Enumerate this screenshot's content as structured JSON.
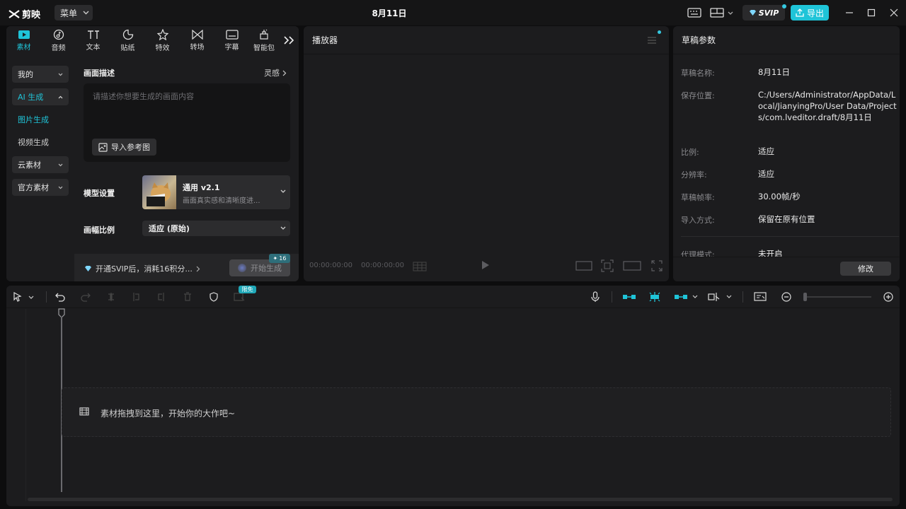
{
  "app": {
    "name": "剪映",
    "menu_label": "菜单",
    "title": "8月11日",
    "svip_label": "SVIP",
    "export_label": "导出"
  },
  "colors": {
    "accent": "#1fc4d8",
    "bg": "#0d0d0e",
    "panel": "#1c1c1e"
  },
  "media_tabs": [
    {
      "label": "素材",
      "icon": "media-icon",
      "active": true
    },
    {
      "label": "音频",
      "icon": "audio-icon"
    },
    {
      "label": "文本",
      "icon": "text-icon"
    },
    {
      "label": "贴纸",
      "icon": "sticker-icon"
    },
    {
      "label": "特效",
      "icon": "effects-icon"
    },
    {
      "label": "转场",
      "icon": "transition-icon"
    },
    {
      "label": "字幕",
      "icon": "subtitle-icon"
    },
    {
      "label": "智能包",
      "icon": "smart-icon"
    }
  ],
  "side_nav": {
    "mine": "我的",
    "ai_gen": "AI 生成",
    "image_gen": "图片生成",
    "video_gen": "视频生成",
    "cloud": "云素材",
    "official": "官方素材"
  },
  "ai_panel": {
    "desc_title": "画面描述",
    "inspiration": "灵感",
    "placeholder": "请描述你想要生成的画面内容",
    "import_ref": "导入参考图",
    "model_label": "模型设置",
    "model_name": "通用 v2.1",
    "model_desc": "画面真实感和清晰度进...",
    "ratio_label": "画幅比例",
    "ratio_value": "适应 (原始)",
    "svip_promo": "开通SVIP后，消耗16积分...",
    "generate": "开始生成",
    "cost": "16"
  },
  "player": {
    "title": "播放器",
    "time_current": "00:00:00:00",
    "time_total": "00:00:00:00"
  },
  "draft": {
    "title": "草稿参数",
    "rows": [
      {
        "key": "草稿名称:",
        "value": "8月11日"
      },
      {
        "key": "保存位置:",
        "value": "C:/Users/Administrator/AppData/Local/JianyingPro/User Data/Projects/com.lveditor.draft/8月11日"
      },
      {
        "key": "比例:",
        "value": "适应"
      },
      {
        "key": "分辨率:",
        "value": "适应"
      },
      {
        "key": "草稿帧率:",
        "value": "30.00帧/秒"
      },
      {
        "key": "导入方式:",
        "value": "保留在原有位置"
      },
      {
        "key": "代理模式:",
        "value": "未开启"
      }
    ],
    "edit": "修改"
  },
  "timeline": {
    "limited_free": "限免",
    "drop_hint": "素材拖拽到这里，开始你的大作吧~"
  }
}
